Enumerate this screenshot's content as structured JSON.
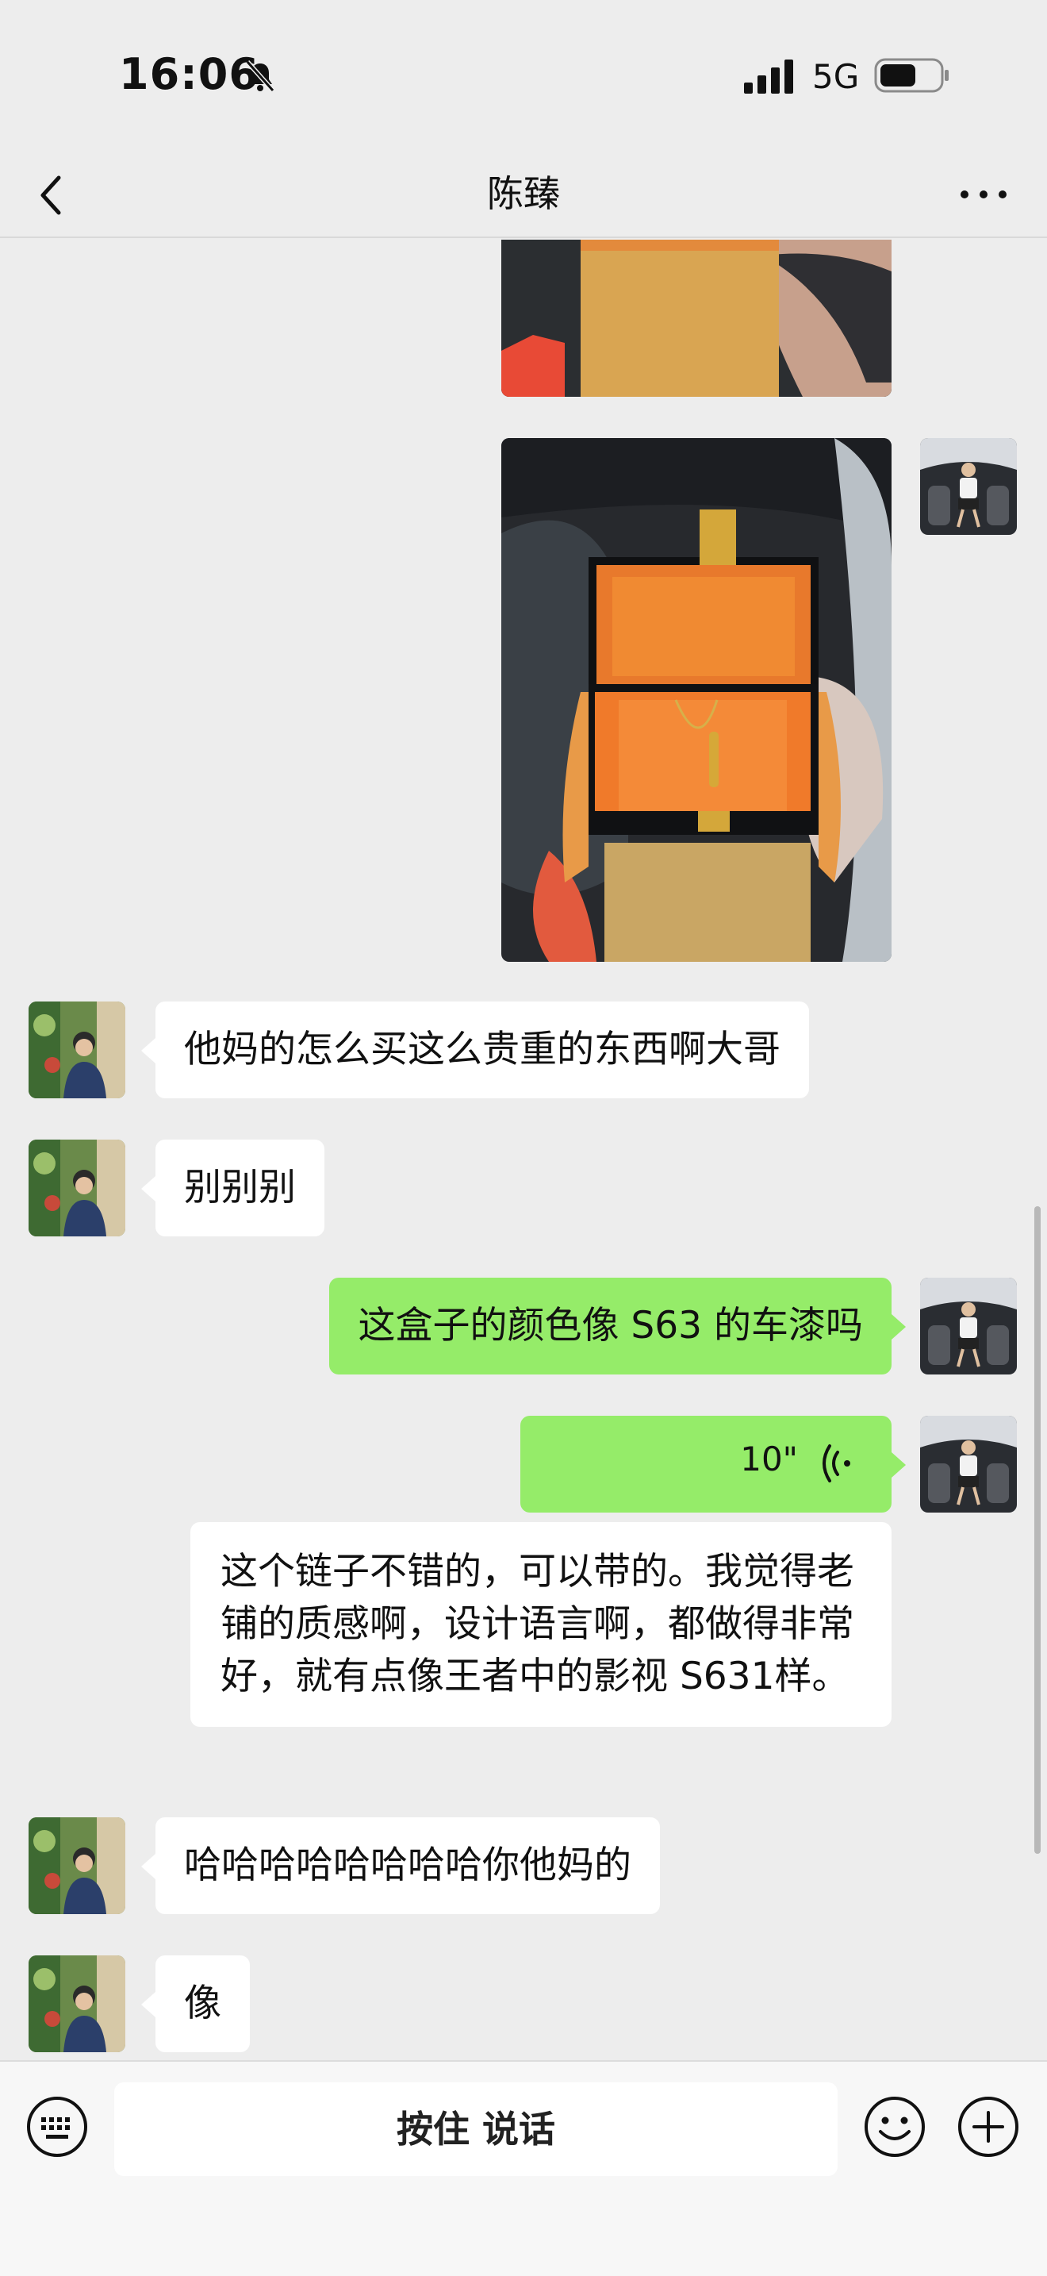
{
  "status_bar": {
    "time": "16:06",
    "network": "5G"
  },
  "header": {
    "title": "陈臻"
  },
  "messages": {
    "m1": "他妈的怎么买这么贵重的东西啊大哥",
    "m2": "别别别",
    "m3": "这盒子的颜色像 S63 的车漆吗",
    "voice_duration": "10\"",
    "transcript": "这个链子不错的，可以带的。我觉得老铺的质感啊，设计语言啊，都做得非常好，就有点像王者中的影视 S631样。",
    "m5": "哈哈哈哈哈哈哈哈你他妈的",
    "m6": "像"
  },
  "input_bar": {
    "hold_to_talk": "按住 说话"
  },
  "colors": {
    "sent_bubble": "#95ec69",
    "received_bubble": "#ffffff",
    "background": "#ededed"
  },
  "icons": [
    "bell-slash-icon",
    "signal-icon",
    "battery-icon",
    "back-chevron-icon",
    "more-icon",
    "voice-wave-icon",
    "keyboard-icon",
    "emoji-icon",
    "plus-icon"
  ]
}
